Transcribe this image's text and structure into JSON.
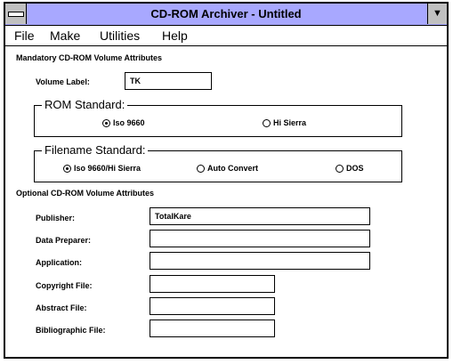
{
  "window": {
    "title": "CD-ROM Archiver - Untitled"
  },
  "menu": [
    {
      "label": "File"
    },
    {
      "label": "Make"
    },
    {
      "label": "Utilities"
    },
    {
      "label": "Help"
    }
  ],
  "mandatory": {
    "heading": "Mandatory CD-ROM Volume Attributes",
    "volume_label": {
      "label": "Volume Label:",
      "value": "TK"
    },
    "rom_standard": {
      "legend": "ROM Standard:",
      "options": [
        {
          "label": "Iso 9660",
          "selected": true
        },
        {
          "label": "Hi Sierra",
          "selected": false
        }
      ]
    },
    "filename_standard": {
      "legend": "Filename Standard:",
      "options": [
        {
          "label": "Iso 9660/Hi Sierra",
          "selected": true
        },
        {
          "label": "Auto Convert",
          "selected": false
        },
        {
          "label": "DOS",
          "selected": false
        }
      ]
    }
  },
  "optional": {
    "heading": "Optional CD-ROM Volume Attributes",
    "fields": [
      {
        "label": "Publisher:",
        "value": "TotalKare"
      },
      {
        "label": "Data Preparer:",
        "value": ""
      },
      {
        "label": "Application:",
        "value": ""
      },
      {
        "label": "Copyright File:",
        "value": ""
      },
      {
        "label": "Abstract File:",
        "value": ""
      },
      {
        "label": "Bibliographic File:",
        "value": ""
      }
    ]
  }
}
